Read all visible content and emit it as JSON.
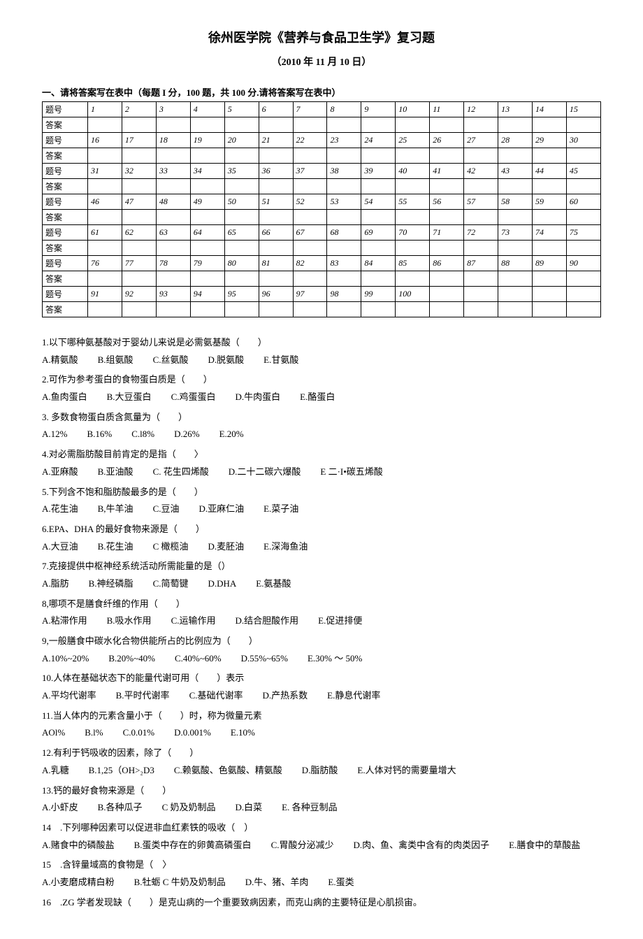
{
  "title": "徐州医学院《营养与食品卫生学》复习题",
  "subtitle": "（2010 年 11 月 10 日）",
  "section1_heading": "一、请将答案写在表中（每题 I 分，100 题，共 100 分.请将答案写在表中）",
  "grid": {
    "rowlabel_q": "题号",
    "rowlabel_a": "答案",
    "rows": [
      [
        "1",
        "2",
        "3",
        "4",
        "5",
        "6",
        "7",
        "8",
        "9",
        "10",
        "11",
        "12",
        "13",
        "14",
        "15"
      ],
      [
        "16",
        "17",
        "18",
        "19",
        "20",
        "21",
        "22",
        "23",
        "24",
        "25",
        "26",
        "27",
        "28",
        "29",
        "30"
      ],
      [
        "31",
        "32",
        "33",
        "34",
        "35",
        "36",
        "37",
        "38",
        "39",
        "40",
        "41",
        "42",
        "43",
        "44",
        "45"
      ],
      [
        "46",
        "47",
        "48",
        "49",
        "50",
        "51",
        "52",
        "53",
        "54",
        "55",
        "56",
        "57",
        "58",
        "59",
        "60"
      ],
      [
        "61",
        "62",
        "63",
        "64",
        "65",
        "66",
        "67",
        "68",
        "69",
        "70",
        "71",
        "72",
        "73",
        "74",
        "75"
      ],
      [
        "76",
        "77",
        "78",
        "79",
        "80",
        "81",
        "82",
        "83",
        "84",
        "85",
        "86",
        "87",
        "88",
        "89",
        "90"
      ],
      [
        "91",
        "92",
        "93",
        "94",
        "95",
        "96",
        "97",
        "98",
        "99",
        "100",
        "",
        "",
        "",
        "",
        ""
      ]
    ]
  },
  "questions": [
    {
      "q": "1.以下哪种氨基酸对于婴幼儿来说是必需氨基酸（　　）",
      "opts": [
        "A.精氨酸",
        "B.组氨酸",
        "C.丝氨酸",
        "D.脱氨酸",
        "E.甘氨酸"
      ]
    },
    {
      "q": "2.可作为参考蛋白的食物蛋白质是（　　）",
      "opts": [
        "A.鱼肉蛋白",
        "B.大豆蛋白",
        "C.鸡蛋蛋白",
        "D.牛肉蛋白",
        "E.酪蛋白"
      ]
    },
    {
      "q": "3. 多数食物蛋白质含氮量为（　　）",
      "opts": [
        "A.12%",
        "B.16%",
        "C.l8%",
        "D.26%",
        "E.20%"
      ]
    },
    {
      "q": "4.对必需脂肪酸目前肯定的是指（　　〉",
      "opts": [
        "A.亚麻酸",
        "B.亚油酸",
        "C. 花生四烯酸",
        "D.二十二碳六爆酸",
        "E 二·I•碳五烯酸"
      ]
    },
    {
      "q": "5.下列含不饱和脂肪酸最多的是（　　）",
      "opts": [
        "A.花生油",
        "B,牛羊油",
        "C.豆油",
        "D.亚麻仁油",
        "E.菜子油"
      ]
    },
    {
      "q": "6.EPA、DHA 的最好食物来源是（　　）",
      "opts": [
        "A.大豆油",
        "B.花生油",
        "C 橄榄油",
        "D.麦胚油",
        "E.深海鱼油"
      ]
    },
    {
      "q": "7.克接提供中枢神经系统活动所需能量的是（）",
      "opts": [
        "A.脂肪",
        "B.神经磷脂",
        "C.简萄键",
        "D.DHA",
        "E.氨基酸"
      ]
    },
    {
      "q": "8,哪项不是膳食纤维的作用（　　）",
      "opts": [
        "A.粘滞作用",
        "B.吸水作用",
        "C.运输作用",
        "D.结合胆酸作用",
        "E.促进排便"
      ]
    },
    {
      "q": "9,一般膳食中碳水化合物供能所占的比例应为（　　）",
      "opts": [
        "A.10%~20%",
        "B.20%~40%",
        "C.40%~60%",
        "D.55%~65%",
        "E.30% ～ 50%"
      ]
    },
    {
      "q": "10.人体在基础状态下的能量代谢可用（　　）表示",
      "opts": [
        "A.平均代谢率",
        "B.平时代谢率",
        "C.基础代谢率",
        "D.产热系数",
        "E.静息代谢率"
      ]
    },
    {
      "q": "11.当人体内的元素含量小于（　　）时，称为微量元素",
      "opts": [
        "AOl%",
        "B.l%",
        "C.0.01%",
        "D.0.001%",
        "E.10%"
      ]
    },
    {
      "q": "12.有利于钙吸收的因素，除了（　　）",
      "opts": [
        "A.乳糖",
        "B.1,25（OH>₂D3",
        "C.赖氨酸、色氨酸、精氨酸",
        "D.脂肪酸",
        "E.人体对钙的需要量增大"
      ]
    },
    {
      "q": "13.钙的最好食物来源是（　　）",
      "opts": [
        "A.小虾皮",
        "B.各种瓜子",
        "C 奶及奶制品",
        "D.白菜",
        "E. 各种豆制品"
      ]
    },
    {
      "q": "14　.下列哪种因素可以促进非血红素铁的吸收（　）",
      "opts": [
        "A.赌食中的磷酸盐",
        "B.蛋类中存在的卵黄高磷蛋白",
        "C.胃酸分泌减少",
        "D.肉、鱼、禽类中含有的肉类因子",
        "E.膳食中的草酸盐"
      ]
    },
    {
      "q": "15　.含锌量域高的食物是（　〉",
      "opts": [
        "A.小麦磨成精白粉",
        "B.牡蛎 C 牛奶及奶制品",
        "D.牛、猪、羊肉",
        "E.蛋类"
      ]
    },
    {
      "q": "16　.ZG 学者发现缺（　　）是克山病的一个重要致病因素，而克山病的主要特征是心肌损宙。",
      "opts": []
    }
  ]
}
